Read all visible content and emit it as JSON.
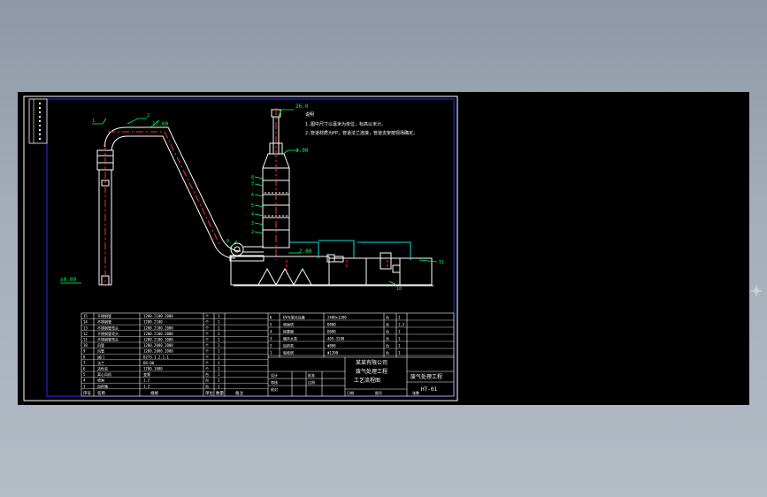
{
  "drawing": {
    "elevations": {
      "duct_top": "17.00",
      "stack_top": "26.0",
      "tower_upper": "3.00",
      "ground_left": "±0.00",
      "pump_level": "2.00"
    },
    "notes": {
      "title": "说明",
      "line1": "1.图中尺寸以毫米为单位，标高以米计。",
      "line2": "2.管道材质为PP，管道法兰连接，管道支架按现场确定。"
    },
    "title_block": {
      "project_line1": "某某有限公司",
      "project_line2": "废气处理工程",
      "project_line3": "工艺流程图",
      "drawing_name": "废气处理工程",
      "drawing_no": "HT-01",
      "labels": [
        "设计",
        "审核",
        "校对",
        "批准",
        "比例",
        "日期",
        "图号",
        "张数"
      ],
      "row_values": [
        "",
        "",
        "",
        "1:2",
        "",
        "",
        "",
        ""
      ]
    },
    "bom_header": [
      "序号",
      "名称",
      "规格",
      "单位",
      "数量",
      "备注"
    ],
    "bom_left": [
      [
        "15",
        "不锈钢管",
        "1200.2100.2000",
        "个",
        "1"
      ],
      [
        "14",
        "不锈钢管",
        "1200.2100",
        "个",
        "1"
      ],
      [
        "13",
        "不锈钢管弯头",
        "1200.2100.2000",
        "个",
        "1"
      ],
      [
        "12",
        "不锈钢管弯头",
        "1200.2100.2000",
        "个",
        "1"
      ],
      [
        "11",
        "不锈钢管弯头",
        "1200.2100.2000",
        "个",
        "1"
      ],
      [
        "10",
        "风管",
        "1200.2000.2000",
        "个",
        "1"
      ],
      [
        "9",
        "风管",
        "1200.2000.2000",
        "个",
        "1"
      ],
      [
        "8",
        "阀门",
        "D273.1.2.1.1",
        "个",
        "1"
      ],
      [
        "7",
        "法兰",
        "D8.00",
        "个",
        "1"
      ],
      [
        "6",
        "活性炭",
        "1700.1000",
        "个",
        "1"
      ],
      [
        "5",
        "离心风机",
        "变频",
        "台",
        "1"
      ],
      [
        "4",
        "喷淋",
        "1.2",
        "台",
        "1"
      ],
      [
        "3",
        "加药箱",
        "1.2",
        "台",
        "1"
      ]
    ],
    "bom_right": [
      [
        "6",
        "UV光氧化设备",
        "2400x1200",
        "台",
        "1"
      ],
      [
        "5",
        "喷淋塔",
        "D800",
        "台",
        "1,2"
      ],
      [
        "4",
        "除雾器",
        "D800",
        "台",
        "1"
      ],
      [
        "3",
        "循环水泵",
        "40X-3200",
        "台",
        "1"
      ],
      [
        "2",
        "加药泵",
        "Φ800",
        "台",
        "1"
      ],
      [
        "1",
        "吸收塔",
        "Φ1200",
        "台",
        "1"
      ]
    ]
  },
  "colors": {
    "background": "#8e98a6",
    "canvas": "#000000",
    "frame": "#ffffff",
    "border_blue": "#2a2aff",
    "leader": "#00ff66",
    "centerline": "#ff3030",
    "pipe": "#00e5e5"
  }
}
